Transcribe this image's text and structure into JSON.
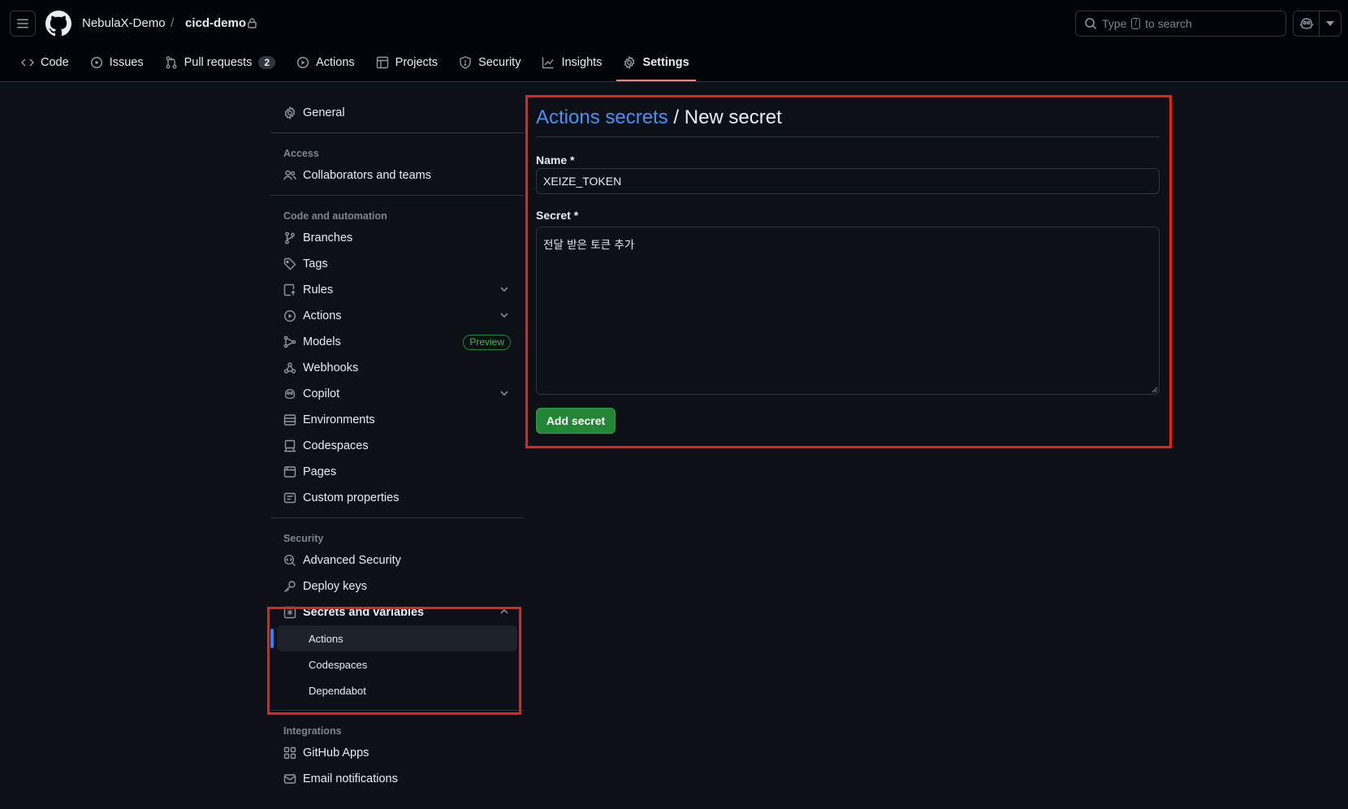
{
  "header": {
    "owner": "NebulaX-Demo",
    "separator": "/",
    "repo": "cicd-demo",
    "search_prefix": "Type",
    "search_key": "/",
    "search_suffix": "to search"
  },
  "tabs": [
    {
      "label": "Code",
      "icon": "code-icon"
    },
    {
      "label": "Issues",
      "icon": "issue-icon"
    },
    {
      "label": "Pull requests",
      "icon": "pull-request-icon",
      "count": "2"
    },
    {
      "label": "Actions",
      "icon": "play-icon"
    },
    {
      "label": "Projects",
      "icon": "table-icon"
    },
    {
      "label": "Security",
      "icon": "shield-icon"
    },
    {
      "label": "Insights",
      "icon": "graph-icon"
    },
    {
      "label": "Settings",
      "icon": "gear-icon",
      "active": true
    }
  ],
  "sidebar": {
    "general": "General",
    "access_label": "Access",
    "collaborators": "Collaborators and teams",
    "code_label": "Code and automation",
    "branches": "Branches",
    "tags": "Tags",
    "rules": "Rules",
    "actions": "Actions",
    "models": "Models",
    "models_badge": "Preview",
    "webhooks": "Webhooks",
    "copilot": "Copilot",
    "environments": "Environments",
    "codespaces": "Codespaces",
    "pages": "Pages",
    "custom_properties": "Custom properties",
    "security_label": "Security",
    "advanced_security": "Advanced Security",
    "deploy_keys": "Deploy keys",
    "secrets_vars": "Secrets and variables",
    "sub_actions": "Actions",
    "sub_codespaces": "Codespaces",
    "sub_dependabot": "Dependabot",
    "integrations_label": "Integrations",
    "github_apps": "GitHub Apps",
    "email_notifications": "Email notifications"
  },
  "main": {
    "title_link": "Actions secrets",
    "title_rest": " / New secret",
    "name_label": "Name *",
    "name_value": "XEIZE_TOKEN",
    "secret_label": "Secret *",
    "secret_value": "전달 받은 토큰 추가",
    "add_button": "Add secret"
  },
  "colors": {
    "accent_link": "#4493f8",
    "primary_button": "#238636",
    "active_tab_underline": "#f78166",
    "highlight_box": "#e5231b"
  }
}
